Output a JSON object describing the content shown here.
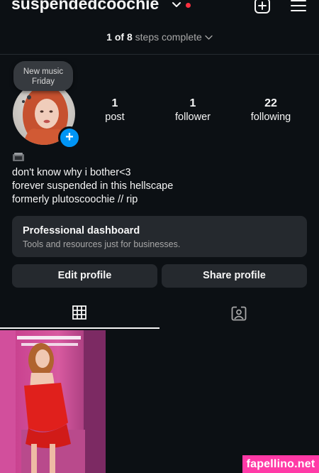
{
  "header": {
    "username": "suspendedcoochie",
    "chevron_icon": "chevron-down-icon",
    "notification_dot_color": "#ff3040",
    "create_icon": "plus-square-icon",
    "menu_icon": "hamburger-menu-icon"
  },
  "steps": {
    "count": "1 of 8",
    "label": "steps complete"
  },
  "note": {
    "line1": "New music",
    "line2": "Friday"
  },
  "stats": {
    "posts": {
      "value": "1",
      "label": "post"
    },
    "followers": {
      "value": "1",
      "label": "follower"
    },
    "following": {
      "value": "22",
      "label": "following"
    }
  },
  "bio": {
    "emoji_icon": "film-camera-icon",
    "line1": "don't know why i bother<3",
    "line2": "forever suspended in this hellscape",
    "line3": "formerly plutoscoochie // rip"
  },
  "dashboard": {
    "title": "Professional dashboard",
    "subtitle": "Tools and resources just for businesses."
  },
  "buttons": {
    "edit": "Edit profile",
    "share": "Share profile"
  },
  "tabs": {
    "grid_icon": "grid-icon",
    "tagged_icon": "tagged-person-icon"
  },
  "watermark": "fapellino.net",
  "colors": {
    "background": "#0c1014",
    "card": "#25292e",
    "accent_blue": "#0095f6",
    "watermark_pink": "#ff3aa6"
  }
}
